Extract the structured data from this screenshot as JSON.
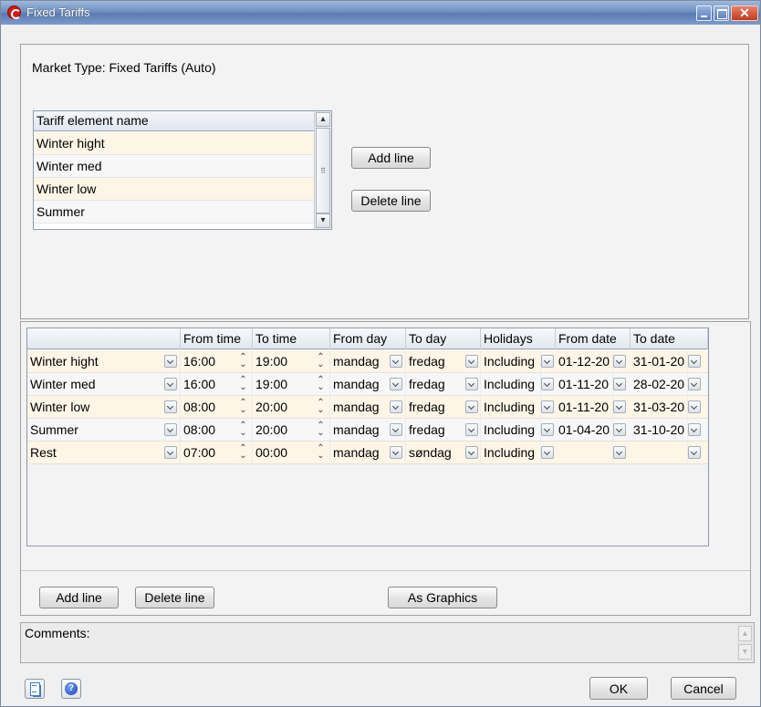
{
  "window": {
    "title": "Fixed Tariffs"
  },
  "market_type_label": "Market Type: Fixed Tariffs (Auto)",
  "tariff_list": {
    "header": "Tariff element name",
    "items": [
      "Winter hight",
      "Winter med",
      "Winter low",
      "Summer"
    ]
  },
  "top_buttons": {
    "add_line": "Add line",
    "delete_line": "Delete line"
  },
  "grid": {
    "columns": [
      "",
      "From time",
      "To time",
      "From day",
      "To day",
      "Holidays",
      "From date",
      "To date"
    ],
    "rows": [
      {
        "name": "Winter hight",
        "from_time": "16:00",
        "to_time": "19:00",
        "from_day": "mandag",
        "to_day": "fredag",
        "holidays": "Including",
        "from_date": "01-12-20",
        "to_date": "31-01-20"
      },
      {
        "name": "Winter med",
        "from_time": "16:00",
        "to_time": "19:00",
        "from_day": "mandag",
        "to_day": "fredag",
        "holidays": "Including",
        "from_date": "01-11-20",
        "to_date": "28-02-20"
      },
      {
        "name": "Winter low",
        "from_time": "08:00",
        "to_time": "20:00",
        "from_day": "mandag",
        "to_day": "fredag",
        "holidays": "Including",
        "from_date": "01-11-20",
        "to_date": "31-03-20"
      },
      {
        "name": "Summer",
        "from_time": "08:00",
        "to_time": "20:00",
        "from_day": "mandag",
        "to_day": "fredag",
        "holidays": "Including",
        "from_date": "01-04-20",
        "to_date": "31-10-20"
      },
      {
        "name": "Rest",
        "from_time": "07:00",
        "to_time": "00:00",
        "from_day": "mandag",
        "to_day": "søndag",
        "holidays": "Including",
        "from_date": "",
        "to_date": ""
      }
    ]
  },
  "bottom_buttons": {
    "add_line": "Add line",
    "delete_line": "Delete line",
    "as_graphics": "As Graphics"
  },
  "comments_label": "Comments:",
  "footer": {
    "ok": "OK",
    "cancel": "Cancel"
  },
  "icons": {
    "app": "app-logo-icon",
    "doc": "document-icon",
    "help": "help-icon"
  }
}
